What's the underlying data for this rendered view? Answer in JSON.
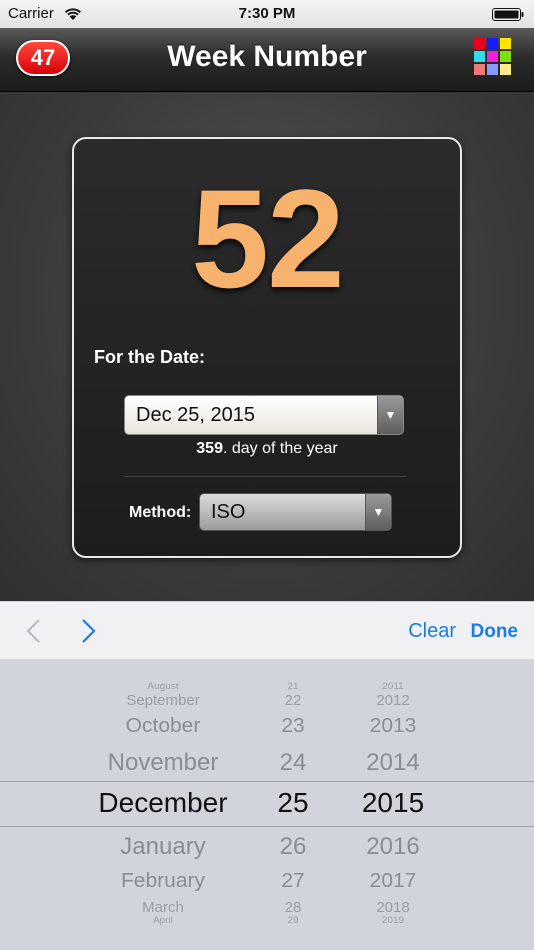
{
  "status_bar": {
    "carrier": "Carrier",
    "time": "7:30 PM"
  },
  "nav": {
    "badge": "47",
    "title": "Week Number",
    "grid_colors": [
      "#e8001c",
      "#1a1aff",
      "#ffe600",
      "#33ddee",
      "#ee22dd",
      "#7ee010",
      "#f07a7a",
      "#8899ff",
      "#ffee88"
    ]
  },
  "card": {
    "week_number": "52",
    "for_date_label": "For the Date:",
    "date_value": "Dec 25, 2015",
    "day_number": "359",
    "day_suffix": ". day of the year",
    "method_label": "Method:",
    "method_value": "ISO"
  },
  "toolbar": {
    "clear": "Clear",
    "done": "Done"
  },
  "picker": {
    "months": [
      "August",
      "September",
      "October",
      "November",
      "December",
      "January",
      "February",
      "March",
      "April"
    ],
    "days": [
      "21",
      "22",
      "23",
      "24",
      "25",
      "26",
      "27",
      "28",
      "29"
    ],
    "years": [
      "2011",
      "2012",
      "2013",
      "2014",
      "2015",
      "2016",
      "2017",
      "2018",
      "2019"
    ],
    "selected_index": 4
  },
  "colors": {
    "accent": "#1a7de0",
    "week_number": "#f7b36d",
    "badge": "#d8000a"
  }
}
